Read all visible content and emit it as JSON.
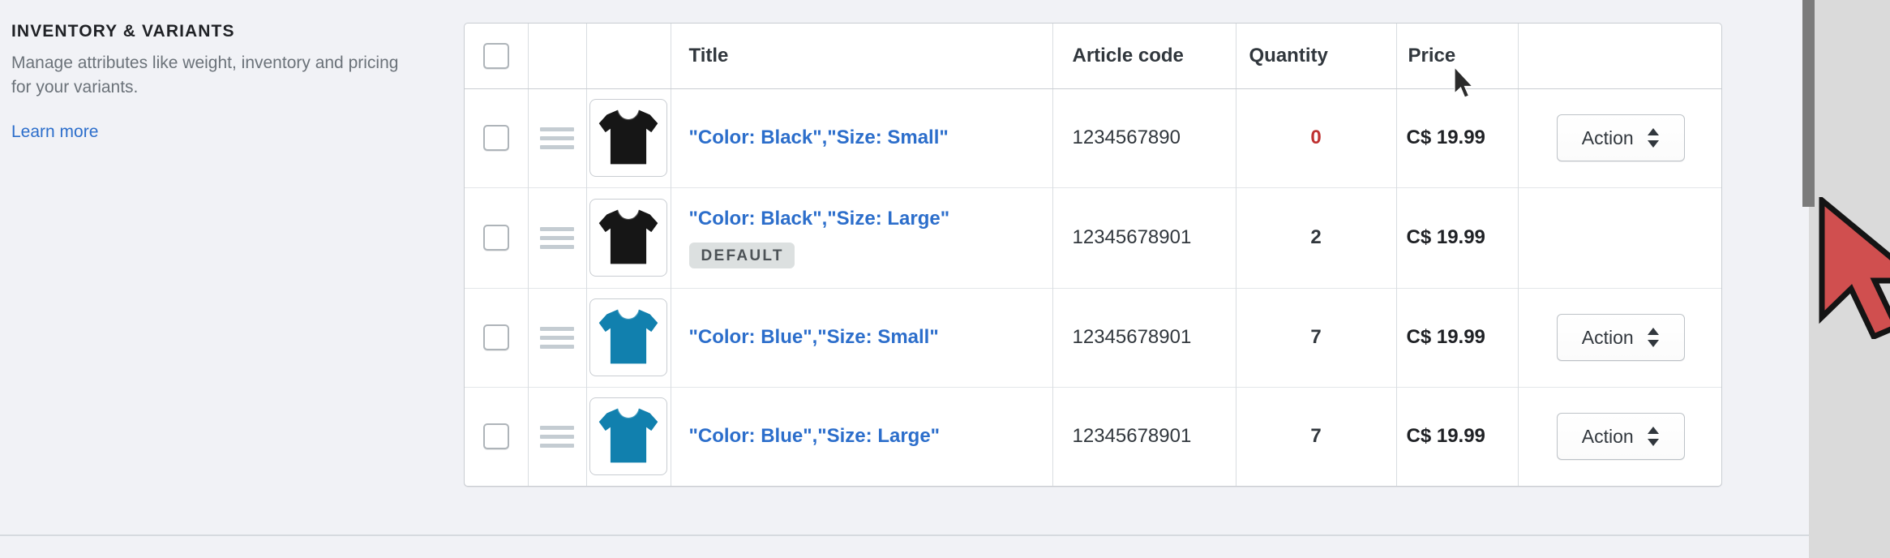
{
  "side_panel": {
    "title": "INVENTORY & VARIANTS",
    "description": "Manage attributes like weight, inventory and pricing for your variants.",
    "learn_more": "Learn more"
  },
  "table": {
    "columns": [
      {
        "key": "select",
        "label": ""
      },
      {
        "key": "handle",
        "label": ""
      },
      {
        "key": "thumb",
        "label": ""
      },
      {
        "key": "title",
        "label": "Title"
      },
      {
        "key": "article",
        "label": "Article code"
      },
      {
        "key": "qty",
        "label": "Quantity"
      },
      {
        "key": "price",
        "label": "Price"
      },
      {
        "key": "action",
        "label": ""
      }
    ],
    "rows": [
      {
        "title": "\"Color: Black\",\"Size: Small\"",
        "badge": "",
        "article_code": "1234567890",
        "quantity": "0",
        "quantity_state": "zero",
        "price": "C$ 19.99",
        "shirt_color": "#161616",
        "has_action": true,
        "action_label": "Action"
      },
      {
        "title": "\"Color: Black\",\"Size: Large\"",
        "badge": "DEFAULT",
        "article_code": "12345678901",
        "quantity": "2",
        "quantity_state": "normal",
        "price": "C$ 19.99",
        "shirt_color": "#161616",
        "has_action": false,
        "action_label": ""
      },
      {
        "title": "\"Color: Blue\",\"Size: Small\"",
        "badge": "",
        "article_code": "12345678901",
        "quantity": "7",
        "quantity_state": "normal",
        "price": "C$ 19.99",
        "shirt_color": "#1180ae",
        "has_action": true,
        "action_label": "Action"
      },
      {
        "title": "\"Color: Blue\",\"Size: Large\"",
        "badge": "",
        "article_code": "12345678901",
        "quantity": "7",
        "quantity_state": "normal",
        "price": "C$ 19.99",
        "shirt_color": "#1180ae",
        "has_action": true,
        "action_label": "Action"
      }
    ]
  },
  "colors": {
    "link": "#2c6ecb",
    "quantity_zero": "#bf3131",
    "badge_background": "#dce0e0",
    "page_background": "#f1f2f6",
    "shirt_black": "#161616",
    "shirt_blue": "#1180ae",
    "cursor_red": "#d04f4f",
    "scrollbar_thumb": "#7b7b7b"
  },
  "icons": {
    "drag_handle": "drag-handle-icon",
    "checkbox": "checkbox-icon",
    "select_caret": "select-caret-icon",
    "tshirt": "tshirt-icon",
    "cursor": "cursor-arrow-icon"
  }
}
